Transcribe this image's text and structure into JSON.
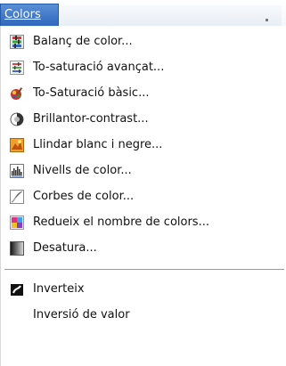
{
  "menubar": {
    "title": "Colors"
  },
  "menu": {
    "items": [
      {
        "label": "Balanç de color...",
        "icon": "color-balance-icon"
      },
      {
        "label": "To-saturació avançat...",
        "icon": "hue-saturation-icon"
      },
      {
        "label": "To-Saturació bàsic...",
        "icon": "colorize-icon"
      },
      {
        "label": "Brillantor-contrast...",
        "icon": "brightness-contrast-icon"
      },
      {
        "label": "Llindar blanc i negre...",
        "icon": "threshold-icon"
      },
      {
        "label": "Nivells de color...",
        "icon": "levels-icon"
      },
      {
        "label": "Corbes de color...",
        "icon": "curves-icon"
      },
      {
        "label": "Redueix el nombre de colors...",
        "icon": "posterize-icon"
      },
      {
        "label": "Desatura...",
        "icon": "desaturate-icon"
      },
      {
        "label": "Inverteix",
        "icon": "invert-icon"
      },
      {
        "label": "Inversió de valor",
        "icon": ""
      }
    ]
  }
}
